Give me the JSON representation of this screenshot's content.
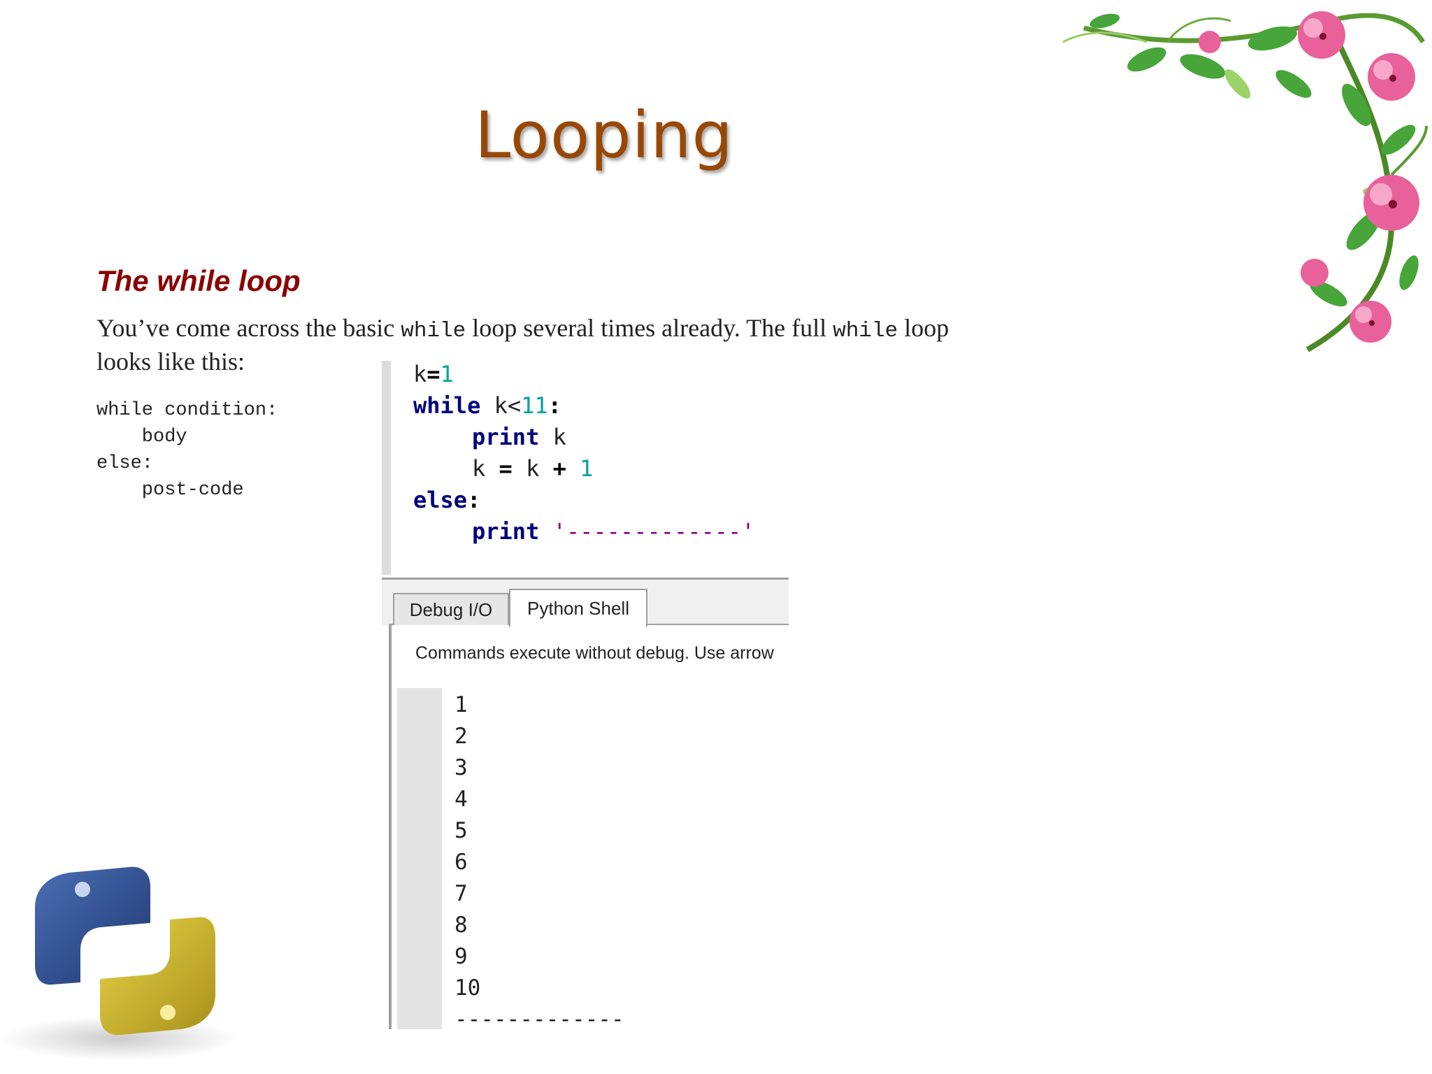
{
  "slide": {
    "title": "Looping",
    "heading": "The while loop",
    "intro": {
      "line1_part1": "You’ve come across the basic ",
      "line1_code1": "while",
      "line1_part2": " loop several times already. The full ",
      "line1_code2": "while",
      "line1_part3": " loop",
      "line2": "looks like this:"
    },
    "syntax_lines": [
      "while condition:",
      "    body",
      "else:",
      "    post-code"
    ]
  },
  "code": {
    "l1_var": "k",
    "l1_op": "=",
    "l1_num": "1",
    "l2_kw": "while",
    "l2_rest": " k<",
    "l2_num": "11",
    "l2_colon": ":",
    "l3_kw": "print",
    "l3_rest": " k",
    "l4_a": "k ",
    "l4_eq": "=",
    "l4_b": " k ",
    "l4_plus": "+",
    "l4_num": "1",
    "l5_kw": "else",
    "l5_colon": ":",
    "l6_kw": "print",
    "l6_str": "'-------------'"
  },
  "ide": {
    "tabs": [
      {
        "label": "Debug I/O",
        "active": false
      },
      {
        "label": "Python Shell",
        "active": true
      }
    ],
    "shell_hint": "Commands execute without debug.  Use arrow",
    "output": [
      "1",
      "2",
      "3",
      "4",
      "5",
      "6",
      "7",
      "8",
      "9",
      "10",
      "-------------"
    ]
  },
  "colors": {
    "title": "#984806",
    "heading": "#8b0000",
    "keyword": "#00007f",
    "number": "#00a0a0",
    "string": "#7f007f"
  },
  "decorations": [
    "floral-corner",
    "python-logo"
  ]
}
